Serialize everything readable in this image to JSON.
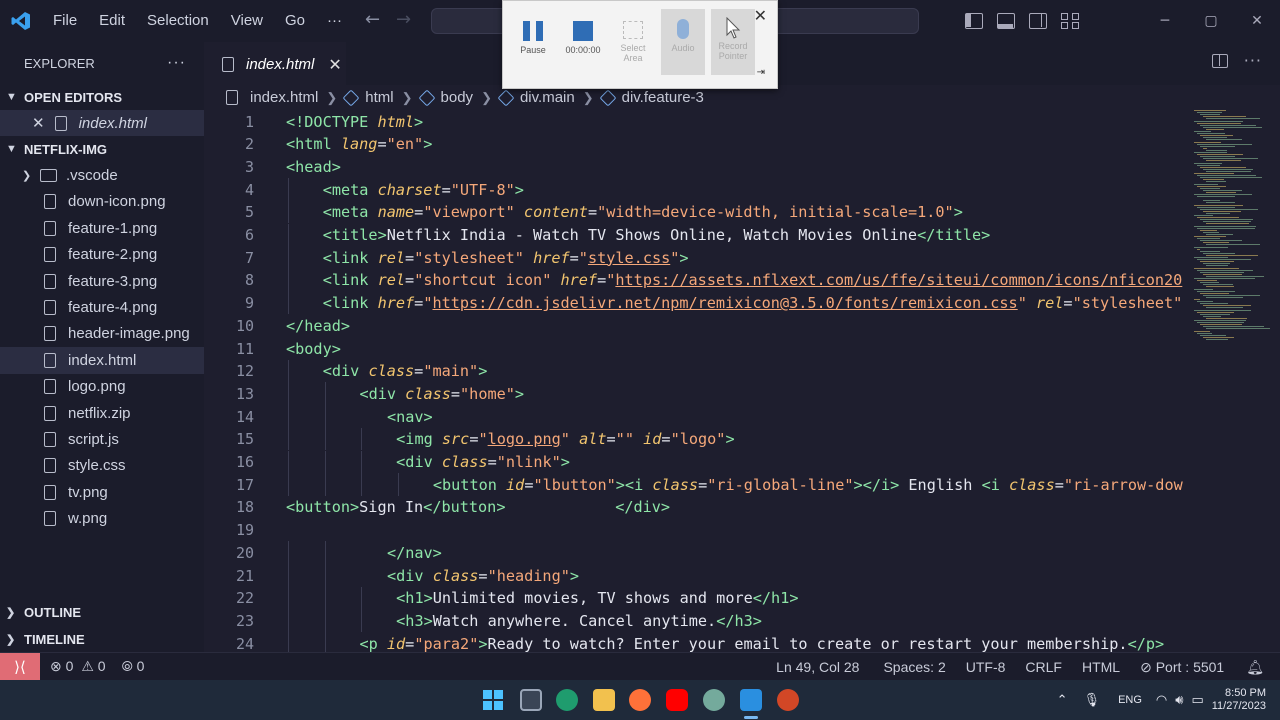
{
  "menu": [
    "File",
    "Edit",
    "Selection",
    "View",
    "Go",
    "···"
  ],
  "explorer": {
    "title": "EXPLORER",
    "open_editors_label": "OPEN EDITORS",
    "open_file": "index.html",
    "folder_label": "NETFLIX-IMG",
    "items": [
      {
        "name": ".vscode",
        "type": "folder"
      },
      {
        "name": "down-icon.png",
        "type": "file"
      },
      {
        "name": "feature-1.png",
        "type": "file"
      },
      {
        "name": "feature-2.png",
        "type": "file"
      },
      {
        "name": "feature-3.png",
        "type": "file"
      },
      {
        "name": "feature-4.png",
        "type": "file"
      },
      {
        "name": "header-image.png",
        "type": "file"
      },
      {
        "name": "index.html",
        "type": "file",
        "active": true
      },
      {
        "name": "logo.png",
        "type": "file"
      },
      {
        "name": "netflix.zip",
        "type": "file"
      },
      {
        "name": "script.js",
        "type": "file"
      },
      {
        "name": "style.css",
        "type": "file"
      },
      {
        "name": "tv.png",
        "type": "file"
      },
      {
        "name": "w.png",
        "type": "file"
      }
    ],
    "outline_label": "OUTLINE",
    "timeline_label": "TIMELINE"
  },
  "tab": {
    "label": "index.html"
  },
  "breadcrumb": [
    "index.html",
    "html",
    "body",
    "div.main",
    "div.feature-3"
  ],
  "recorder": {
    "pause": "Pause",
    "timer": "00:00:00",
    "select_area": "Select Area",
    "audio": "Audio",
    "record_pointer": "Record Pointer"
  },
  "code_lines": [
    {
      "n": "1",
      "i": 0,
      "seg": [
        [
          "tag",
          "<!DOCTYPE "
        ],
        [
          "attr",
          "html"
        ],
        [
          "tag",
          ">"
        ]
      ]
    },
    {
      "n": "2",
      "i": 0,
      "seg": [
        [
          "tag",
          "<html "
        ],
        [
          "attr",
          "lang"
        ],
        [
          "txt",
          "="
        ],
        [
          "str",
          "\"en\""
        ],
        [
          "tag",
          ">"
        ]
      ]
    },
    {
      "n": "3",
      "i": 0,
      "seg": [
        [
          "tag",
          "<head>"
        ]
      ]
    },
    {
      "n": "4",
      "i": 1,
      "seg": [
        [
          "tag",
          "<meta "
        ],
        [
          "attr",
          "charset"
        ],
        [
          "txt",
          "="
        ],
        [
          "str",
          "\"UTF-8\""
        ],
        [
          "tag",
          ">"
        ]
      ]
    },
    {
      "n": "5",
      "i": 1,
      "seg": [
        [
          "tag",
          "<meta "
        ],
        [
          "attr",
          "name"
        ],
        [
          "txt",
          "="
        ],
        [
          "str",
          "\"viewport\" "
        ],
        [
          "attr",
          "content"
        ],
        [
          "txt",
          "="
        ],
        [
          "str",
          "\"width=device-width, initial-scale=1.0\""
        ],
        [
          "tag",
          ">"
        ]
      ]
    },
    {
      "n": "6",
      "i": 1,
      "seg": [
        [
          "tag",
          "<title>"
        ],
        [
          "txt",
          "Netflix India - Watch TV Shows Online, Watch Movies Online"
        ],
        [
          "tag",
          "</title>"
        ]
      ]
    },
    {
      "n": "7",
      "i": 1,
      "seg": [
        [
          "tag",
          "<link "
        ],
        [
          "attr",
          "rel"
        ],
        [
          "txt",
          "="
        ],
        [
          "str",
          "\"stylesheet\" "
        ],
        [
          "attr",
          "href"
        ],
        [
          "txt",
          "="
        ],
        [
          "str",
          "\""
        ],
        [
          "link",
          "style.css"
        ],
        [
          "str",
          "\""
        ],
        [
          "tag",
          ">"
        ]
      ]
    },
    {
      "n": "8",
      "i": 1,
      "seg": [
        [
          "tag",
          "<link "
        ],
        [
          "attr",
          "rel"
        ],
        [
          "txt",
          "="
        ],
        [
          "str",
          "\"shortcut icon\" "
        ],
        [
          "attr",
          "href"
        ],
        [
          "txt",
          "="
        ],
        [
          "str",
          "\""
        ],
        [
          "link",
          "https://assets.nflxext.com/us/ffe/siteui/common/icons/nficon20"
        ]
      ]
    },
    {
      "n": "9",
      "i": 1,
      "seg": [
        [
          "tag",
          "<link "
        ],
        [
          "attr",
          "href"
        ],
        [
          "txt",
          "="
        ],
        [
          "str",
          "\""
        ],
        [
          "link",
          "https://cdn.jsdelivr.net/npm/remixicon@3.5.0/fonts/remixicon.css"
        ],
        [
          "str",
          "\" "
        ],
        [
          "attr",
          "rel"
        ],
        [
          "txt",
          "="
        ],
        [
          "str",
          "\"stylesheet\""
        ]
      ]
    },
    {
      "n": "10",
      "i": 0,
      "seg": [
        [
          "tag",
          "</head>"
        ]
      ]
    },
    {
      "n": "11",
      "i": 0,
      "seg": [
        [
          "tag",
          "<body>"
        ]
      ]
    },
    {
      "n": "12",
      "i": 1,
      "seg": [
        [
          "tag",
          "<div "
        ],
        [
          "attr",
          "class"
        ],
        [
          "txt",
          "="
        ],
        [
          "str",
          "\"main\""
        ],
        [
          "tag",
          ">"
        ]
      ]
    },
    {
      "n": "13",
      "i": 2,
      "seg": [
        [
          "tag",
          "<div "
        ],
        [
          "attr",
          "class"
        ],
        [
          "txt",
          "="
        ],
        [
          "str",
          "\"home\""
        ],
        [
          "tag",
          ">"
        ]
      ]
    },
    {
      "n": "14",
      "i": 2.75,
      "seg": [
        [
          "tag",
          "<nav>"
        ]
      ]
    },
    {
      "n": "15",
      "i": 3,
      "seg": [
        [
          "tag",
          "<img "
        ],
        [
          "attr",
          "src"
        ],
        [
          "txt",
          "="
        ],
        [
          "str",
          "\""
        ],
        [
          "link",
          "logo.png"
        ],
        [
          "str",
          "\" "
        ],
        [
          "attr",
          "alt"
        ],
        [
          "txt",
          "="
        ],
        [
          "str",
          "\"\" "
        ],
        [
          "attr",
          "id"
        ],
        [
          "txt",
          "="
        ],
        [
          "str",
          "\"logo\""
        ],
        [
          "tag",
          ">"
        ]
      ]
    },
    {
      "n": "16",
      "i": 3,
      "seg": [
        [
          "tag",
          "<div "
        ],
        [
          "attr",
          "class"
        ],
        [
          "txt",
          "="
        ],
        [
          "str",
          "\"nlink\""
        ],
        [
          "tag",
          ">"
        ]
      ]
    },
    {
      "n": "17",
      "i": 4,
      "seg": [
        [
          "tag",
          "<button "
        ],
        [
          "attr",
          "id"
        ],
        [
          "txt",
          "="
        ],
        [
          "str",
          "\"lbutton\""
        ],
        [
          "tag",
          "><i "
        ],
        [
          "attr",
          "class"
        ],
        [
          "txt",
          "="
        ],
        [
          "str",
          "\"ri-global-line\""
        ],
        [
          "tag",
          "></i>"
        ],
        [
          "txt",
          " English "
        ],
        [
          "tag",
          "<i "
        ],
        [
          "attr",
          "class"
        ],
        [
          "txt",
          "="
        ],
        [
          "str",
          "\"ri-arrow-dow"
        ]
      ]
    },
    {
      "n": "18",
      "i": 0,
      "seg": [
        [
          "tag",
          "<button>"
        ],
        [
          "txt",
          "Sign In"
        ],
        [
          "tag",
          "</button>"
        ],
        [
          "txt",
          "            "
        ],
        [
          "tag",
          "</div>"
        ]
      ]
    },
    {
      "n": "19",
      "i": 0,
      "seg": []
    },
    {
      "n": "20",
      "i": 2.75,
      "seg": [
        [
          "tag",
          "</nav>"
        ]
      ]
    },
    {
      "n": "21",
      "i": 2.75,
      "seg": [
        [
          "tag",
          "<div "
        ],
        [
          "attr",
          "class"
        ],
        [
          "txt",
          "="
        ],
        [
          "str",
          "\"heading\""
        ],
        [
          "tag",
          ">"
        ]
      ]
    },
    {
      "n": "22",
      "i": 3,
      "seg": [
        [
          "tag",
          "<h1>"
        ],
        [
          "txt",
          "Unlimited movies, TV shows and more"
        ],
        [
          "tag",
          "</h1>"
        ]
      ]
    },
    {
      "n": "23",
      "i": 3,
      "seg": [
        [
          "tag",
          "<h3>"
        ],
        [
          "txt",
          "Watch anywhere. Cancel anytime."
        ],
        [
          "tag",
          "</h3>"
        ]
      ]
    },
    {
      "n": "24",
      "i": 2,
      "seg": [
        [
          "tag",
          "<p "
        ],
        [
          "attr",
          "id"
        ],
        [
          "txt",
          "="
        ],
        [
          "str",
          "\"para2\""
        ],
        [
          "tag",
          ">"
        ],
        [
          "txt",
          "Ready to watch? Enter your email to create or restart your membership."
        ],
        [
          "tag",
          "</p>"
        ]
      ]
    }
  ],
  "status": {
    "errors": "0",
    "warnings": "0",
    "ports": "0",
    "position": "Ln 49, Col 28",
    "spaces": "Spaces: 2",
    "encoding": "UTF-8",
    "eol": "CRLF",
    "language": "HTML",
    "port": "Port : 5501"
  },
  "tray": {
    "lang": "ENG",
    "time": "8:50 PM",
    "date": "11/27/2023"
  },
  "colors": {
    "accent_remote": "#e06c75",
    "tag": "#8ee5a8",
    "attr": "#f2c56f",
    "string": "#f5a87a"
  }
}
